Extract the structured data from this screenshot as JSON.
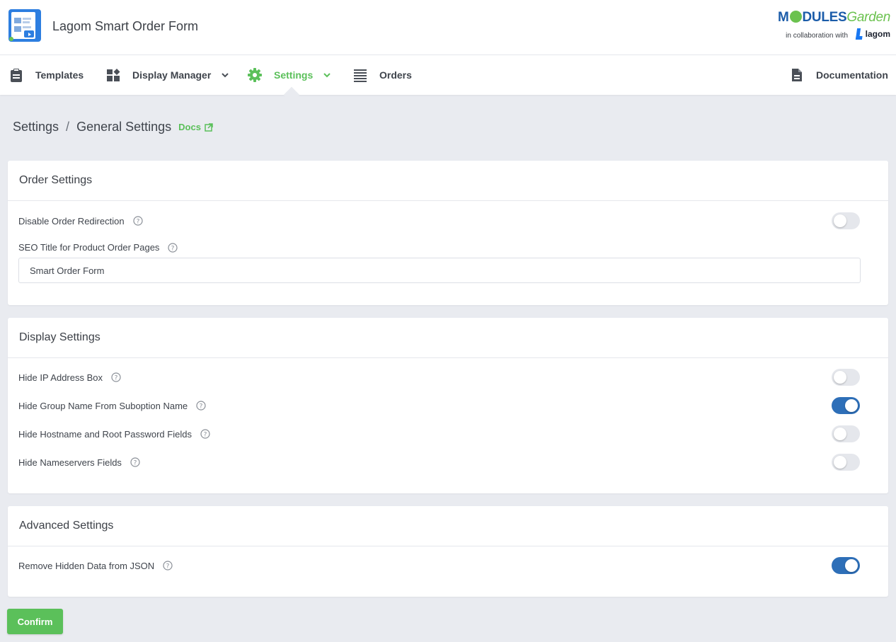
{
  "app": {
    "title": "Lagom Smart Order Form",
    "logo_icon": "order-form-logo-icon"
  },
  "brand": {
    "part1": "M",
    "part2": "DULES",
    "part3": "Garden",
    "collab": "in collaboration with",
    "lagom": "lagom",
    "colors": {
      "blue": "#1b5ca9",
      "green": "#6bc24f"
    }
  },
  "nav": {
    "templates": {
      "label": "Templates",
      "icon": "clipboard-icon"
    },
    "display_manager": {
      "label": "Display Manager",
      "icon": "widgets-icon"
    },
    "settings": {
      "label": "Settings",
      "icon": "gear-icon",
      "active": true
    },
    "orders": {
      "label": "Orders",
      "icon": "list-icon"
    },
    "documentation": {
      "label": "Documentation",
      "icon": "document-icon"
    }
  },
  "breadcrumb": {
    "root": "Settings",
    "separator": "/",
    "current": "General Settings",
    "docs_label": "Docs"
  },
  "order_settings": {
    "title": "Order Settings",
    "disable_redirection": {
      "label": "Disable Order Redirection",
      "enabled": false
    },
    "seo_title": {
      "label": "SEO Title for Product Order Pages",
      "value": "Smart Order Form"
    }
  },
  "display_settings": {
    "title": "Display Settings",
    "items": [
      {
        "label": "Hide IP Address Box",
        "enabled": false
      },
      {
        "label": "Hide Group Name From Suboption Name",
        "enabled": true
      },
      {
        "label": "Hide Hostname and Root Password Fields",
        "enabled": false
      },
      {
        "label": "Hide Nameservers Fields",
        "enabled": false
      }
    ]
  },
  "advanced_settings": {
    "title": "Advanced Settings",
    "remove_hidden": {
      "label": "Remove Hidden Data from JSON",
      "enabled": true
    }
  },
  "actions": {
    "confirm_label": "Confirm"
  },
  "colors": {
    "accent": "#5bc05a",
    "toggle_on": "#2e6fb8",
    "toggle_off": "#e5e7ec",
    "background": "#e9ebf0"
  }
}
